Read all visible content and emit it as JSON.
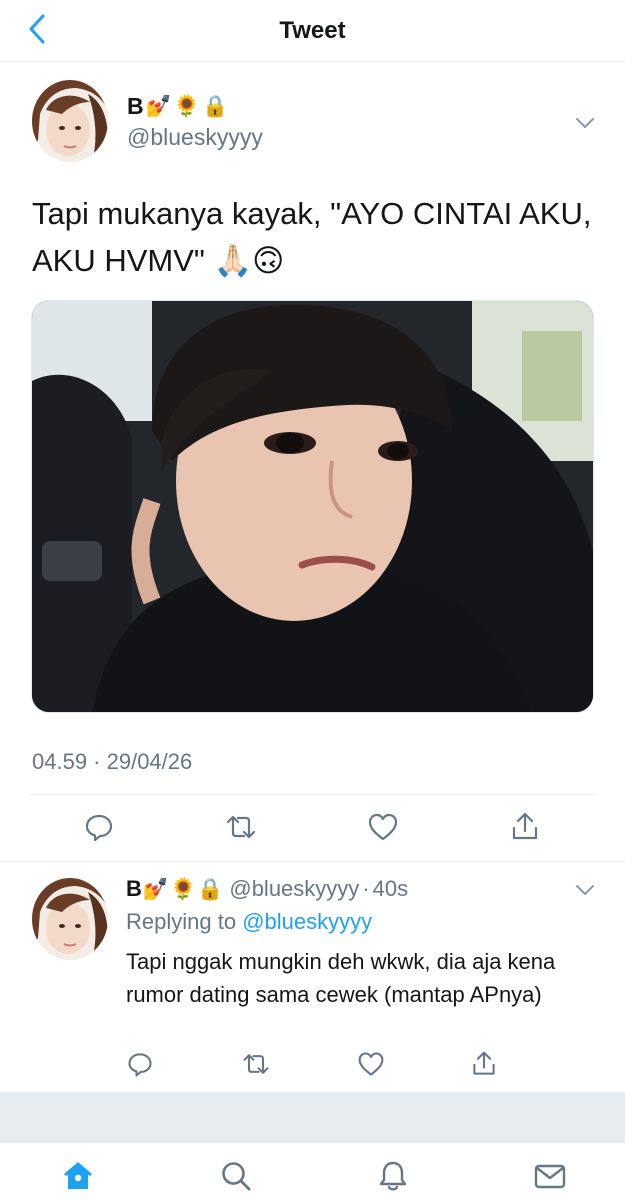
{
  "nav": {
    "title": "Tweet",
    "back_icon": "chevron-left-icon"
  },
  "tweet": {
    "display_name": "B",
    "name_emojis": [
      "💅",
      "🌻",
      "🔒"
    ],
    "handle": "@blueskyyyy",
    "text": "Tapi mukanya kayak, \"AYO CINTAI AKU, AKU HVMV\" 🙏🏻🙃",
    "timestamp": "04.59 · 29/04/26",
    "actions": [
      "reply-icon",
      "retweet-icon",
      "like-icon",
      "share-icon"
    ]
  },
  "reply": {
    "display_name": "B",
    "name_emojis": [
      "💅",
      "🌻",
      "🔒"
    ],
    "handle": "@blueskyyyy",
    "separator": "·",
    "time": "40s",
    "replying_prefix": "Replying to ",
    "replying_handle": "@blueskyyyy",
    "text": "Tapi nggak mungkin deh wkwk, dia aja kena rumor dating sama cewek (mantap APnya)",
    "actions": [
      "reply-icon",
      "retweet-icon",
      "like-icon",
      "share-icon"
    ]
  },
  "tabbar": {
    "items": [
      "home-icon",
      "search-icon",
      "notifications-icon",
      "messages-icon"
    ],
    "active": "home-icon"
  },
  "colors": {
    "accent": "#1da1f2",
    "secondary_text": "#657786",
    "divider": "#e6ecf0"
  }
}
